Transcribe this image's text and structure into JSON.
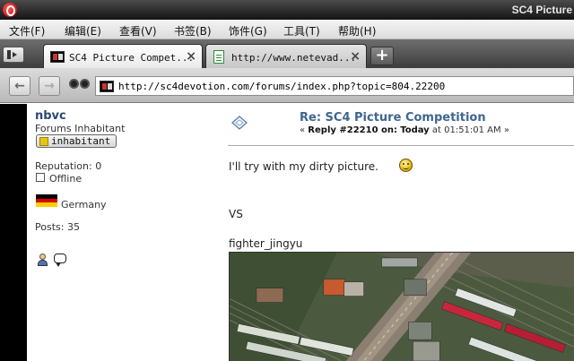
{
  "window": {
    "title": "SC4 Picture"
  },
  "menu": {
    "items": [
      "文件(F)",
      "编辑(E)",
      "查看(V)",
      "书签(B)",
      "饰件(G)",
      "工具(T)",
      "帮助(H)"
    ]
  },
  "tabs": [
    {
      "label": "SC4 Picture Compet...",
      "favicon": "sc4-logo-icon",
      "active": true,
      "close": "×"
    },
    {
      "label": "http://www.netevad...",
      "favicon": "page-icon",
      "active": false,
      "close": "×"
    }
  ],
  "new_tab_label": "+",
  "address": {
    "url": "http://sc4devotion.com/forums/index.php?topic=804.22200"
  },
  "nav": {
    "back": "←",
    "forward": "→"
  },
  "poster": {
    "name": "nbvc",
    "group": "Forums Inhabitant",
    "rank_badge": "inhabitant",
    "reputation": "Reputation: 0",
    "status": "Offline",
    "country": "Germany",
    "posts": "Posts: 35"
  },
  "post": {
    "title": "Re: SC4 Picture Competition",
    "meta_prefix": "« ",
    "meta_reply": "Reply #22210 on:",
    "meta_day": "Today",
    "meta_time": " at 01:51:01 AM »",
    "line1": "I'll try with my dirty picture.",
    "vs": "VS",
    "caption": "fighter_jingyu"
  },
  "colors": {
    "title_bar": "#2a2a2a",
    "link_blue": "#3f6590",
    "username_blue": "#2b4a73",
    "flag": [
      "#000000",
      "#dd0000",
      "#ffce00"
    ]
  }
}
